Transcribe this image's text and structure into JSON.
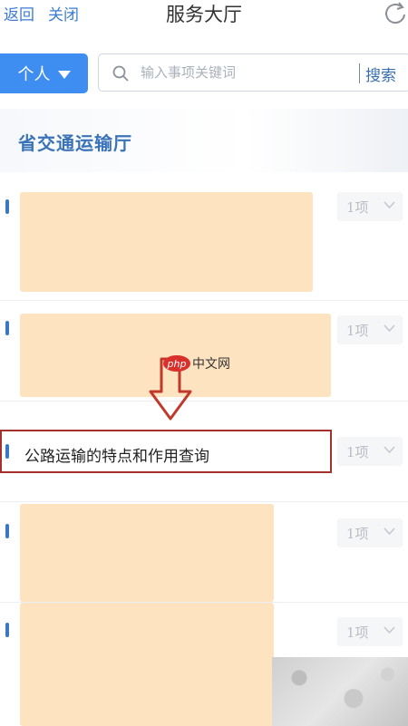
{
  "header": {
    "back_label": "返回",
    "close_label": "关闭",
    "title": "服务大厅",
    "refresh_icon": "refresh-icon"
  },
  "search": {
    "scope_label": "个人",
    "placeholder": "输入事项关键词",
    "button_label": "搜索"
  },
  "department": {
    "title": "省交通运输厅"
  },
  "items": [
    {
      "label": "",
      "count": "1项",
      "redacted": true
    },
    {
      "label": "",
      "count": "1项",
      "redacted": true
    },
    {
      "label": "公路运输的特点和作用查询",
      "count": "1项",
      "redacted": false
    },
    {
      "label": "",
      "count": "1项",
      "redacted": true
    },
    {
      "label": "",
      "count": "1项",
      "redacted": true
    }
  ],
  "watermark": {
    "logo_text": "php",
    "text": "中文网"
  },
  "colors": {
    "accent": "#3d8ef0",
    "title_blue": "#3a73b8",
    "redaction": "#fde3bf",
    "highlight_border": "#a5312f",
    "arrow": "#c0392b"
  }
}
